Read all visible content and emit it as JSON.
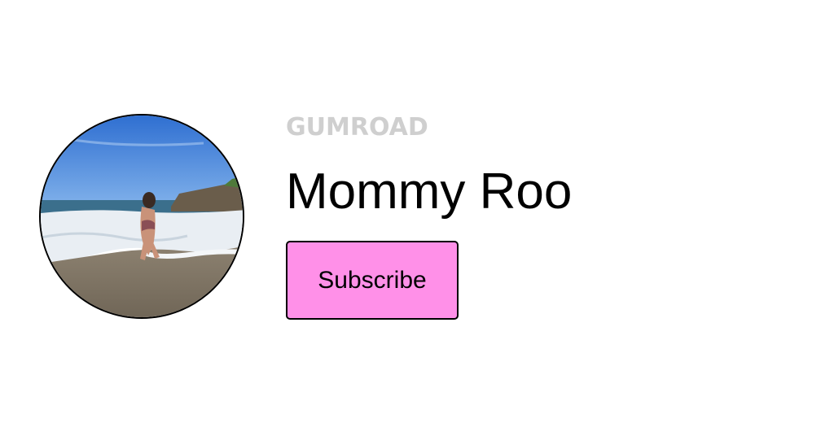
{
  "brand": {
    "logo_text": "GUMROAD"
  },
  "creator": {
    "name": "Mommy Roo"
  },
  "actions": {
    "subscribe_label": "Subscribe"
  },
  "colors": {
    "button_background": "#ff90e8",
    "logo_gray": "#cfcfcf",
    "text": "#000000"
  }
}
